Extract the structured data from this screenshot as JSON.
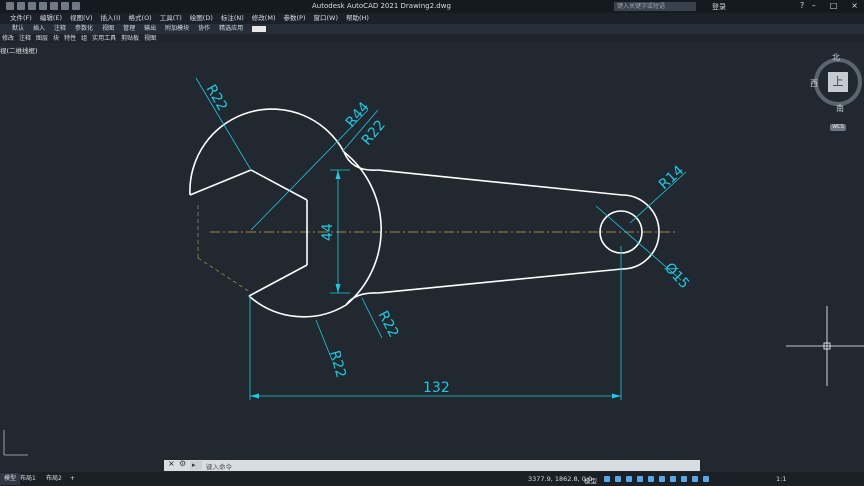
{
  "titlebar": {
    "title": "Autodesk AutoCAD 2021    Drawing2.dwg",
    "search_placeholder": "键入关键字或短语",
    "user": "登录",
    "help_icon": "question-icon"
  },
  "menu": [
    "文件(F)",
    "编辑(E)",
    "视图(V)",
    "插入(I)",
    "格式(O)",
    "工具(T)",
    "绘图(D)",
    "标注(N)",
    "修改(M)",
    "参数(P)",
    "窗口(W)",
    "帮助(H)"
  ],
  "ribbon_tabs": [
    "默认",
    "插入",
    "注释",
    "参数化",
    "视图",
    "管理",
    "输出",
    "附加模块",
    "协作",
    "精选应用"
  ],
  "panels": [
    "修改",
    "注释",
    "图层",
    "块",
    "特性",
    "组",
    "实用工具",
    "剪贴板",
    "视图"
  ],
  "viewport_label": "视(二维线框)",
  "dimensions": {
    "r22_top": "R22",
    "r44": "R44",
    "r22_upper": "R22",
    "r14": "R14",
    "d15": "Ø15",
    "d44": "44",
    "r22_lower": "R22",
    "r22_bottom": "R22",
    "d132": "132"
  },
  "viewcube": {
    "north": "北",
    "west": "西",
    "south": "南",
    "top": "上",
    "wcs": "WCS"
  },
  "command_line": {
    "placeholder": "键入命令"
  },
  "status": {
    "tabs": [
      "模型",
      "布局1",
      "布局2"
    ],
    "coords": "3377.9, 1862.8, 0.0",
    "model": "模型",
    "scale": "1:1"
  }
}
